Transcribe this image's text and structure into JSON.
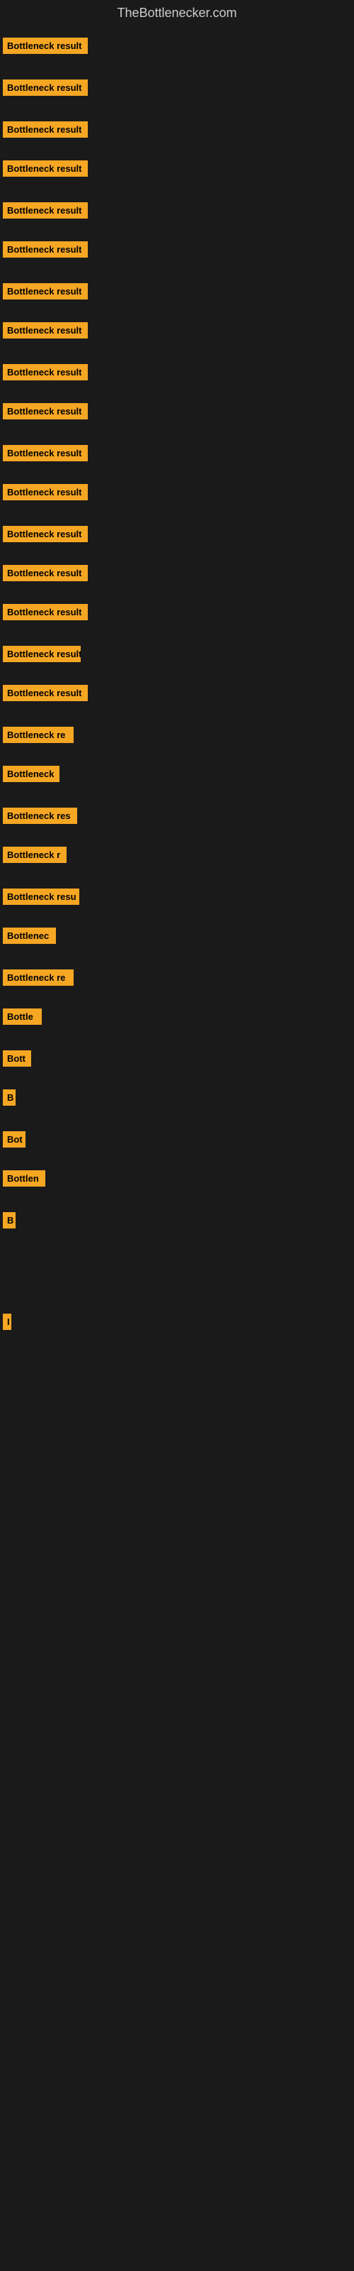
{
  "site": {
    "title": "TheBottlenecker.com"
  },
  "bars": [
    {
      "label": "Bottleneck result",
      "width": 120,
      "marginTop": 8
    },
    {
      "label": "Bottleneck result",
      "width": 120,
      "marginTop": 18
    },
    {
      "label": "Bottleneck result",
      "width": 120,
      "marginTop": 18
    },
    {
      "label": "Bottleneck result",
      "width": 120,
      "marginTop": 14
    },
    {
      "label": "Bottleneck result",
      "width": 120,
      "marginTop": 18
    },
    {
      "label": "Bottleneck result",
      "width": 120,
      "marginTop": 14
    },
    {
      "label": "Bottleneck result",
      "width": 120,
      "marginTop": 18
    },
    {
      "label": "Bottleneck result",
      "width": 120,
      "marginTop": 14
    },
    {
      "label": "Bottleneck result",
      "width": 120,
      "marginTop": 18
    },
    {
      "label": "Bottleneck result",
      "width": 120,
      "marginTop": 14
    },
    {
      "label": "Bottleneck result",
      "width": 120,
      "marginTop": 18
    },
    {
      "label": "Bottleneck result",
      "width": 120,
      "marginTop": 14
    },
    {
      "label": "Bottleneck result",
      "width": 120,
      "marginTop": 18
    },
    {
      "label": "Bottleneck result",
      "width": 120,
      "marginTop": 14
    },
    {
      "label": "Bottleneck result",
      "width": 120,
      "marginTop": 14
    },
    {
      "label": "Bottleneck result",
      "width": 110,
      "marginTop": 18
    },
    {
      "label": "Bottleneck result",
      "width": 120,
      "marginTop": 14
    },
    {
      "label": "Bottleneck re",
      "width": 100,
      "marginTop": 18
    },
    {
      "label": "Bottleneck",
      "width": 80,
      "marginTop": 14
    },
    {
      "label": "Bottleneck res",
      "width": 105,
      "marginTop": 18
    },
    {
      "label": "Bottleneck r",
      "width": 90,
      "marginTop": 14
    },
    {
      "label": "Bottleneck resu",
      "width": 108,
      "marginTop": 18
    },
    {
      "label": "Bottlenec",
      "width": 75,
      "marginTop": 14
    },
    {
      "label": "Bottleneck re",
      "width": 100,
      "marginTop": 18
    },
    {
      "label": "Bottle",
      "width": 55,
      "marginTop": 14
    },
    {
      "label": "Bott",
      "width": 40,
      "marginTop": 18
    },
    {
      "label": "B",
      "width": 18,
      "marginTop": 14
    },
    {
      "label": "Bot",
      "width": 32,
      "marginTop": 18
    },
    {
      "label": "Bottlen",
      "width": 60,
      "marginTop": 14
    },
    {
      "label": "B",
      "width": 18,
      "marginTop": 18
    },
    {
      "label": "",
      "width": 0,
      "marginTop": 40
    },
    {
      "label": "",
      "width": 0,
      "marginTop": 40
    },
    {
      "label": "I",
      "width": 10,
      "marginTop": 18
    },
    {
      "label": "",
      "width": 0,
      "marginTop": 60
    },
    {
      "label": "",
      "width": 0,
      "marginTop": 60
    },
    {
      "label": "",
      "width": 0,
      "marginTop": 60
    }
  ]
}
